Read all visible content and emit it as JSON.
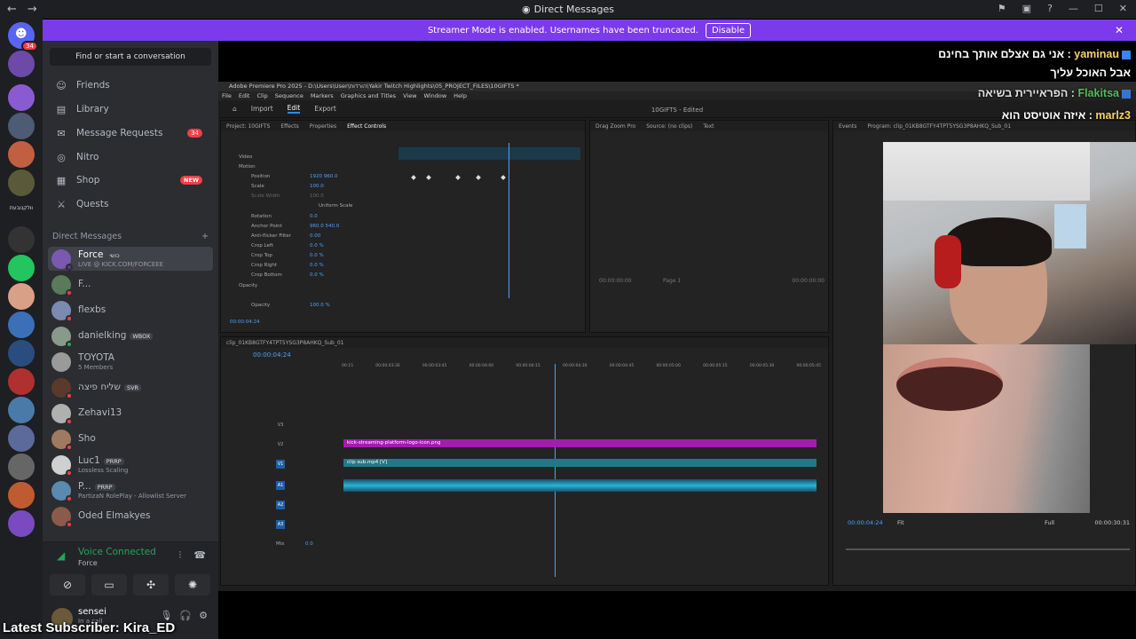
{
  "window": {
    "title": "Direct Messages"
  },
  "banner": {
    "text": "Streamer Mode is enabled. Usernames have been truncated.",
    "disable_label": "Disable"
  },
  "rail": {
    "home_badge": "34",
    "folder_label": "וולקנובעת"
  },
  "sidebar": {
    "search_placeholder": "Find or start a conversation",
    "nav": [
      {
        "label": "Friends"
      },
      {
        "label": "Library"
      },
      {
        "label": "Message Requests",
        "count": "34"
      },
      {
        "label": "Nitro"
      },
      {
        "label": "Shop",
        "badge": "NEW"
      },
      {
        "label": "Quests"
      }
    ],
    "dm_header": "Direct Messages",
    "dms": [
      {
        "name": "Force",
        "tag": "כושי",
        "sub": "LIVE @ KICK.COM/FORCEEE"
      },
      {
        "name": "F...",
        "sub": ""
      },
      {
        "name": "flexbs",
        "sub": ""
      },
      {
        "name": "danielking",
        "tag": "WBOX",
        "sub": ""
      },
      {
        "name": "TOYOTA",
        "sub": "5 Members"
      },
      {
        "name": "שליח פיצה",
        "tag": "SVR",
        "sub": ""
      },
      {
        "name": "Zehavi13",
        "sub": ""
      },
      {
        "name": "Sho",
        "sub": ""
      },
      {
        "name": "Luc1",
        "tag": "PRRP",
        "sub": "Lossless Scaling"
      },
      {
        "name": "P...",
        "tag": "PRRP",
        "sub": "PartizaN RolePlay - Allowlist Server"
      },
      {
        "name": "Oded Elmakyes",
        "sub": ""
      }
    ]
  },
  "voice": {
    "status": "Voice Connected",
    "channel": "Force"
  },
  "user": {
    "name": "sensei",
    "status": "In a call"
  },
  "overlay": {
    "subscriber": "Latest Subscriber: Kira_ED"
  },
  "chat": [
    {
      "user": "yaminau",
      "text": "אני גם אצלם אותך בחינם :"
    },
    {
      "user": "",
      "text": "אבל האוכל עליך"
    },
    {
      "user": "Flakitsa",
      "text": "הפראיירית בשיאה :"
    },
    {
      "user": "marlz3",
      "text": "איזה אוטיסט הוא :"
    }
  ],
  "premiere": {
    "title": "Adobe Premiere Pro 2025 - D:\\Users\\User\\הורדות\\Yakir Twitch Highlights\\05_PROJECT_FILES\\10GIFTS *",
    "menu": [
      "File",
      "Edit",
      "Clip",
      "Sequence",
      "Markers",
      "Graphics and Titles",
      "View",
      "Window",
      "Help"
    ],
    "tabs": [
      "Import",
      "Edit",
      "Export"
    ],
    "center_title": "10GIFTS - Edited",
    "ec_tabs": [
      "Project: 10GIFTS",
      "Effects",
      "Properties",
      "Effect Controls"
    ],
    "ec_rows": [
      {
        "label": "Video",
        "value": ""
      },
      {
        "label": "Motion",
        "value": ""
      },
      {
        "label": "Position",
        "value": "1920    960.0"
      },
      {
        "label": "Scale",
        "value": "100.0"
      },
      {
        "label": "Scale Width",
        "value": "100.0"
      },
      {
        "label": "Uniform Scale",
        "value": ""
      },
      {
        "label": "Rotation",
        "value": "0.0"
      },
      {
        "label": "Anchor Point",
        "value": "960.0    540.0"
      },
      {
        "label": "Anti-flicker Filter",
        "value": "0.00"
      },
      {
        "label": "Crop Left",
        "value": "0.0 %"
      },
      {
        "label": "Crop Top",
        "value": "0.0 %"
      },
      {
        "label": "Crop Right",
        "value": "0.0 %"
      },
      {
        "label": "Crop Bottom",
        "value": "0.0 %"
      },
      {
        "label": "Opacity",
        "value": ""
      },
      {
        "label": "Opacity",
        "value": "100.0 %"
      }
    ],
    "ec_time": "00:00:04:24",
    "source_tabs": [
      "Drag Zoom Pro",
      "Source: (no clips)",
      "Text"
    ],
    "source_times": [
      "00:00:00:00",
      "Page 1",
      "00:00:00:00"
    ],
    "program_tabs": [
      "Events",
      "Program: clip_01KB8GTFY4TPT5YSG3P8AHKQ_Sub_01"
    ],
    "sequence_name": "clip_01KB8GTFY4TPT5YSG3P8AHKQ_Sub_01",
    "timecode": "00:00:04:24",
    "ruler": [
      "00:15",
      "00:00:03:30",
      "00:00:03:45",
      "00:00:04:00",
      "00:00:04:15",
      "00:00:04:30",
      "00:00:04:45",
      "00:00:05:00",
      "00:00:05:15",
      "00:00:05:30",
      "00:00:05:45"
    ],
    "tracks": [
      "V3",
      "V2",
      "V1",
      "A1",
      "A2",
      "A3",
      "Mix"
    ],
    "mix_value": "0.0",
    "clip_v2": "kick-streaming-platform-logo-icon.png",
    "clip_v1": "clip sub.mp4 [V]",
    "program_time": "00:00:04:24",
    "program_fit": "Fit",
    "program_full": "Full",
    "program_duration": "00:00:30:31"
  },
  "colors": {
    "banner": "#7c3aed",
    "accent": "#2d8ceb",
    "clip_v2": "#a21caf",
    "clip_v1": "#1e7a8a",
    "audio": "#2bb4d6"
  }
}
